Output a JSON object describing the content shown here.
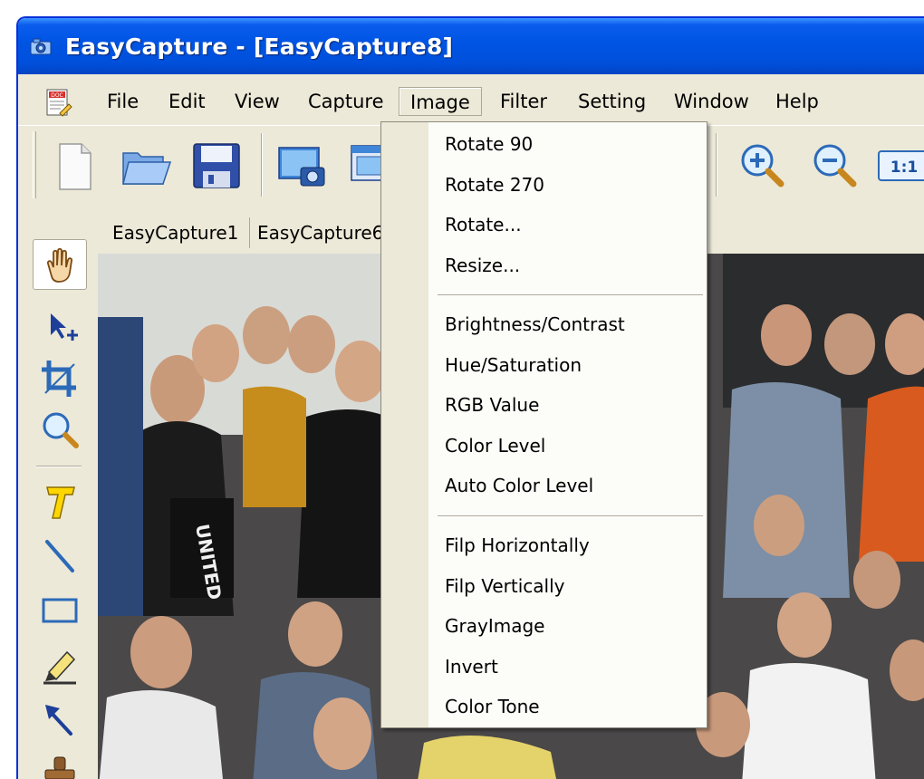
{
  "window": {
    "title": "EasyCapture - [EasyCapture8]"
  },
  "menu": {
    "items": [
      {
        "id": "file",
        "label": "File"
      },
      {
        "id": "edit",
        "label": "Edit"
      },
      {
        "id": "view",
        "label": "View"
      },
      {
        "id": "capture",
        "label": "Capture"
      },
      {
        "id": "image",
        "label": "Image",
        "active": true
      },
      {
        "id": "filter",
        "label": "Filter"
      },
      {
        "id": "setting",
        "label": "Setting"
      },
      {
        "id": "window",
        "label": "Window"
      },
      {
        "id": "help",
        "label": "Help"
      }
    ]
  },
  "toolbar": {
    "buttons": [
      {
        "id": "new",
        "icon": "new-document-icon"
      },
      {
        "id": "open",
        "icon": "open-folder-icon"
      },
      {
        "id": "save",
        "icon": "save-disk-icon"
      },
      {
        "id": "capture-screen",
        "icon": "capture-screen-icon"
      },
      {
        "id": "capture-window",
        "icon": "capture-window-icon"
      },
      {
        "id": "zoom-in",
        "icon": "zoom-in-icon"
      },
      {
        "id": "zoom-out",
        "icon": "zoom-out-icon"
      },
      {
        "id": "actual-size",
        "icon": "actual-size-icon",
        "label": "1:1"
      }
    ]
  },
  "side_tools": [
    {
      "id": "hand",
      "icon": "hand-icon",
      "pressed": true
    },
    {
      "id": "move-select",
      "icon": "move-select-icon"
    },
    {
      "id": "crop",
      "icon": "crop-icon"
    },
    {
      "id": "zoom",
      "icon": "magnifier-icon"
    },
    {
      "id": "text",
      "icon": "text-tool-icon"
    },
    {
      "id": "line",
      "icon": "line-tool-icon"
    },
    {
      "id": "rectangle",
      "icon": "rectangle-tool-icon"
    },
    {
      "id": "highlighter",
      "icon": "highlighter-icon"
    },
    {
      "id": "arrow",
      "icon": "arrow-tool-icon"
    },
    {
      "id": "stamp",
      "icon": "stamp-icon"
    }
  ],
  "doc_tabs": [
    "EasyCapture1",
    "EasyCapture6"
  ],
  "image_menu": {
    "groups": [
      [
        "Rotate 90",
        "Rotate 270",
        "Rotate...",
        "Resize..."
      ],
      [
        "Brightness/Contrast",
        "Hue/Saturation",
        "RGB Value",
        "Color Level",
        "Auto Color Level"
      ],
      [
        "Filp Horizontally",
        "Filp Vertically",
        "GrayImage",
        "Invert",
        "Color Tone"
      ]
    ]
  },
  "colors": {
    "titlebar": "#0054e3",
    "menu_background": "#ece9d8",
    "dropdown_background": "#fcfcf9"
  }
}
